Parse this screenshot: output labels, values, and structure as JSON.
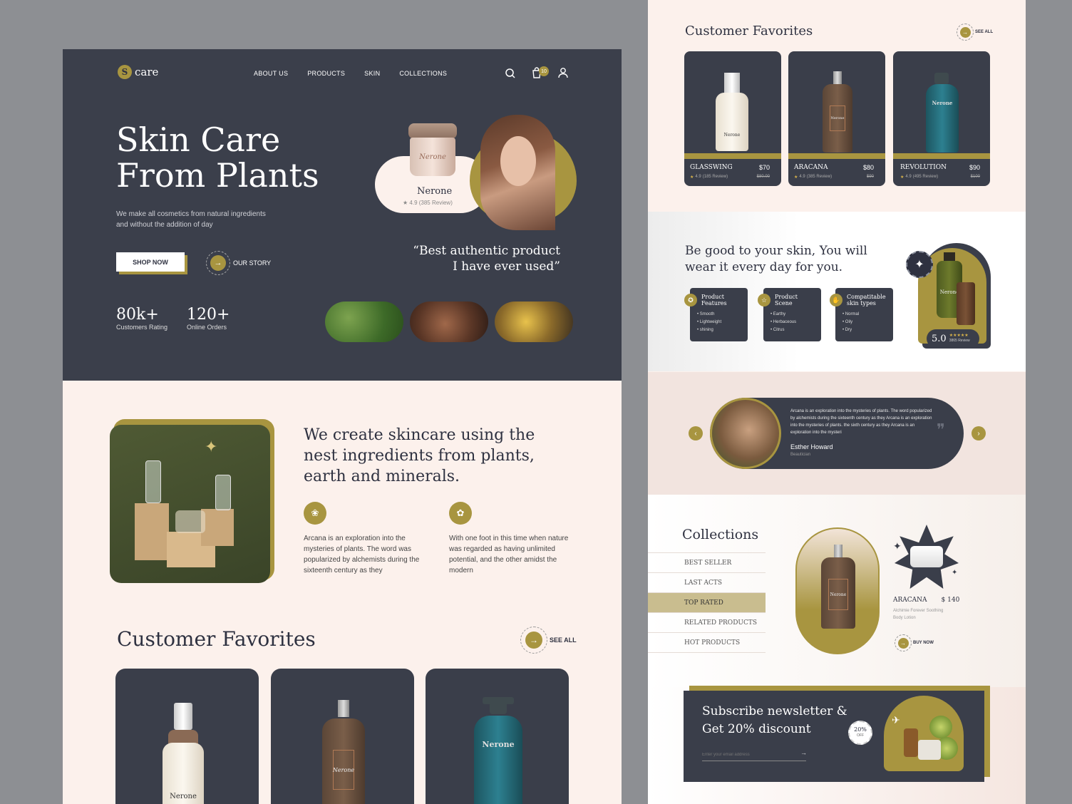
{
  "brand": {
    "logo_letter": "S",
    "name": "care"
  },
  "nav": {
    "items": [
      "ABOUT US",
      "PRODUCTS",
      "SKIN",
      "COLLECTIONS"
    ],
    "cart_count": "10"
  },
  "hero": {
    "title_line1": "Skin Care",
    "title_line2": "From Plants",
    "subtitle_line1": "We make all cosmetics from natural ingredients",
    "subtitle_line2": "and without the addition of day",
    "shop_now": "SHOP NOW",
    "our_story": "OUR STORY",
    "stats": [
      {
        "value": "80k+",
        "label": "Customers Rating"
      },
      {
        "value": "120+",
        "label": "Online Orders"
      }
    ],
    "product_card": {
      "name": "Nerone",
      "rating": "★ 4.9 (385 Review)",
      "jar_label": "Nerone"
    },
    "quote_line1": "“Best authentic product",
    "quote_line2": "I have ever used”"
  },
  "about": {
    "heading_line1": "We create skincare using the",
    "heading_line2": "nest ingredients from plants,",
    "heading_line3": "earth and minerals.",
    "features": [
      {
        "text": "Arcana is an exploration into the mysteries of plants. The word was popularized by alchemists during the sixteenth century as they",
        "icon": "lotus-icon"
      },
      {
        "text": "With one foot in this time when nature was regarded as having unlimited potential, and the other amidst the modern",
        "icon": "flower-icon"
      }
    ]
  },
  "favorites": {
    "title": "Customer Favorites",
    "see_all": "SEE ALL",
    "products": [
      {
        "name": "GLASSWING",
        "price": "$70",
        "old_price": "$80.00",
        "rating": "4.9",
        "reviews": "(185 Review)",
        "bottle_label": "Nerone"
      },
      {
        "name": "ARACANA",
        "price": "$80",
        "old_price": "$90",
        "rating": "4.9",
        "reviews": "(385 Review)",
        "bottle_label": "Nerone"
      },
      {
        "name": "REVOLUTION",
        "price": "$90",
        "old_price": "$100",
        "rating": "4.9",
        "reviews": "(495 Review)",
        "bottle_label": "Nerone"
      }
    ]
  },
  "benefits": {
    "heading_line1": "Be good to your skin, You will",
    "heading_line2": "wear it every day for you.",
    "boxes": [
      {
        "title_line1": "Product",
        "title_line2": "Features",
        "items": [
          "Smooth",
          "Lightweight",
          "shining"
        ]
      },
      {
        "title_line1": "Product",
        "title_line2": "Scene",
        "items": [
          "Earthy",
          "Herbaceous",
          "Citrus"
        ]
      },
      {
        "title_line1": "Compatitable",
        "title_line2": "skin types",
        "items": [
          "Normal",
          "Oily",
          "Dry"
        ]
      }
    ],
    "score": "5.0",
    "score_reviews": "3865 Review",
    "stars": "★★★★★",
    "bottle_label": "Nerone"
  },
  "testimonial": {
    "text": "Arcana is an exploration into the mysteries of plants. The word popularized by alchemists during the sixteenth century as they Arcana is an exploration into the mysteries of plants.  the sixth century as they Arcana is an exploration into the mysteri",
    "name": "Esther Howard",
    "role": "Beautician",
    "quote_mark": "❞"
  },
  "collections": {
    "title": "Collections",
    "items": [
      "BEST SELLER",
      "LAST ACTS",
      "TOP RATED",
      "RELATED PRODUCTS",
      "HOT PRODUCTS"
    ],
    "active_index": 2,
    "product": {
      "name": "ARACANA",
      "price": "$ 140",
      "desc_line1": "Alchimie Forever Soothing",
      "desc_line2": "Body Lotion",
      "buy": "BUY NOW",
      "bottle_label": "Nerone"
    }
  },
  "newsletter": {
    "line1": "Subscribe newsletter &",
    "line2": "Get 20% discount",
    "placeholder": "Enter your email address",
    "badge_pct": "20%",
    "badge_off": "OFF"
  },
  "colors": {
    "dark": "#3a3e4a",
    "gold": "#a89540",
    "cream": "#fcf1ec"
  }
}
